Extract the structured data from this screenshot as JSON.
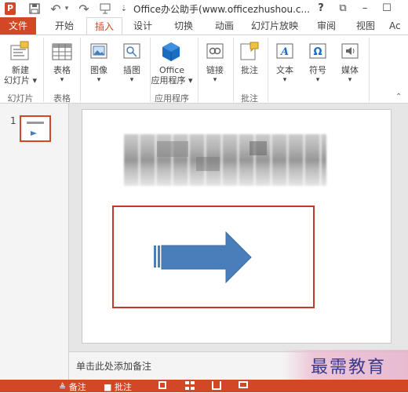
{
  "window": {
    "title": "Office办公助手(www.officezhushou.c...",
    "help": "?",
    "restore": "⧉",
    "minimize": "–",
    "close": "☐"
  },
  "qat": {
    "undo": "↶",
    "redo": "↷",
    "dropdown": "▾"
  },
  "tabs": {
    "file": "文件",
    "items": [
      "开始",
      "插入",
      "设计",
      "切换",
      "动画",
      "幻灯片放映",
      "审阅",
      "视图",
      "Ac"
    ]
  },
  "ribbon": {
    "new_slide": {
      "line1": "新建",
      "line2": "幻灯片 ▾"
    },
    "table": {
      "label": "表格",
      "arrow": "▾"
    },
    "image": {
      "label": "图像",
      "arrow": "▾"
    },
    "illustration": {
      "label": "插图",
      "arrow": "▾"
    },
    "office_apps": {
      "line1": "Office",
      "line2": "应用程序 ▾"
    },
    "link": {
      "label": "链接",
      "arrow": "▾"
    },
    "comment": {
      "label": "批注"
    },
    "text": {
      "label": "文本",
      "arrow": "▾"
    },
    "symbol": {
      "label": "符号",
      "arrow": "▾"
    },
    "media": {
      "label": "媒体",
      "arrow": "▾"
    },
    "groups": {
      "slides": "幻灯片",
      "tables": "表格",
      "apps": "应用程序",
      "comments": "批注"
    }
  },
  "thumbnails": [
    {
      "number": "1"
    }
  ],
  "notes": {
    "placeholder": "单击此处添加备注"
  },
  "watermark": "最需教育",
  "status": {
    "notes": "≜ 备注",
    "comments": "■ 批注"
  },
  "colors": {
    "accent": "#d24726",
    "arrow": "#4a7ebb",
    "frame": "#c0392b"
  }
}
